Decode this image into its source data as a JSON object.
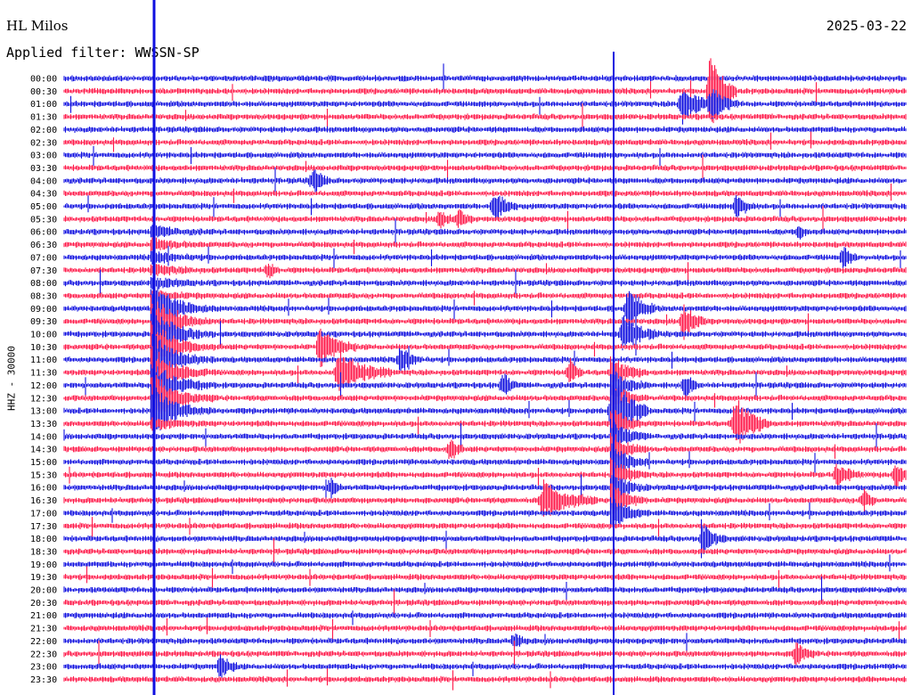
{
  "header": {
    "station": "HL Milos",
    "filter": "Applied filter: WWSSN-SP",
    "date": "2025-03-22"
  },
  "chart_data": {
    "type": "line",
    "title": "HL Milos",
    "subtitle": "Applied filter: WWSSN-SP",
    "date": "2025-03-22",
    "ylabel": "HHZ - 30000",
    "xlabel": "",
    "grid": false,
    "colors": [
      "#1010e0",
      "#ff1a4a"
    ],
    "rows": [
      {
        "label": "00:00"
      },
      {
        "label": "00:30"
      },
      {
        "label": "01:00"
      },
      {
        "label": "01:30"
      },
      {
        "label": "02:00"
      },
      {
        "label": "02:30"
      },
      {
        "label": "03:00"
      },
      {
        "label": "03:30"
      },
      {
        "label": "04:00"
      },
      {
        "label": "04:30"
      },
      {
        "label": "05:00"
      },
      {
        "label": "05:30"
      },
      {
        "label": "06:00"
      },
      {
        "label": "06:30"
      },
      {
        "label": "07:00"
      },
      {
        "label": "07:30"
      },
      {
        "label": "08:00"
      },
      {
        "label": "08:30"
      },
      {
        "label": "09:00"
      },
      {
        "label": "09:30"
      },
      {
        "label": "10:00"
      },
      {
        "label": "10:30"
      },
      {
        "label": "11:00"
      },
      {
        "label": "11:30"
      },
      {
        "label": "12:00"
      },
      {
        "label": "12:30"
      },
      {
        "label": "13:00"
      },
      {
        "label": "13:30"
      },
      {
        "label": "14:00"
      },
      {
        "label": "14:30"
      },
      {
        "label": "15:00"
      },
      {
        "label": "15:30"
      },
      {
        "label": "16:00"
      },
      {
        "label": "16:30"
      },
      {
        "label": "17:00"
      },
      {
        "label": "17:30"
      },
      {
        "label": "18:00"
      },
      {
        "label": "18:30"
      },
      {
        "label": "19:00"
      },
      {
        "label": "19:30"
      },
      {
        "label": "20:00"
      },
      {
        "label": "20:30"
      },
      {
        "label": "21:00"
      },
      {
        "label": "21:30"
      },
      {
        "label": "22:00"
      },
      {
        "label": "22:30"
      },
      {
        "label": "23:00"
      },
      {
        "label": "23:30"
      }
    ]
  }
}
